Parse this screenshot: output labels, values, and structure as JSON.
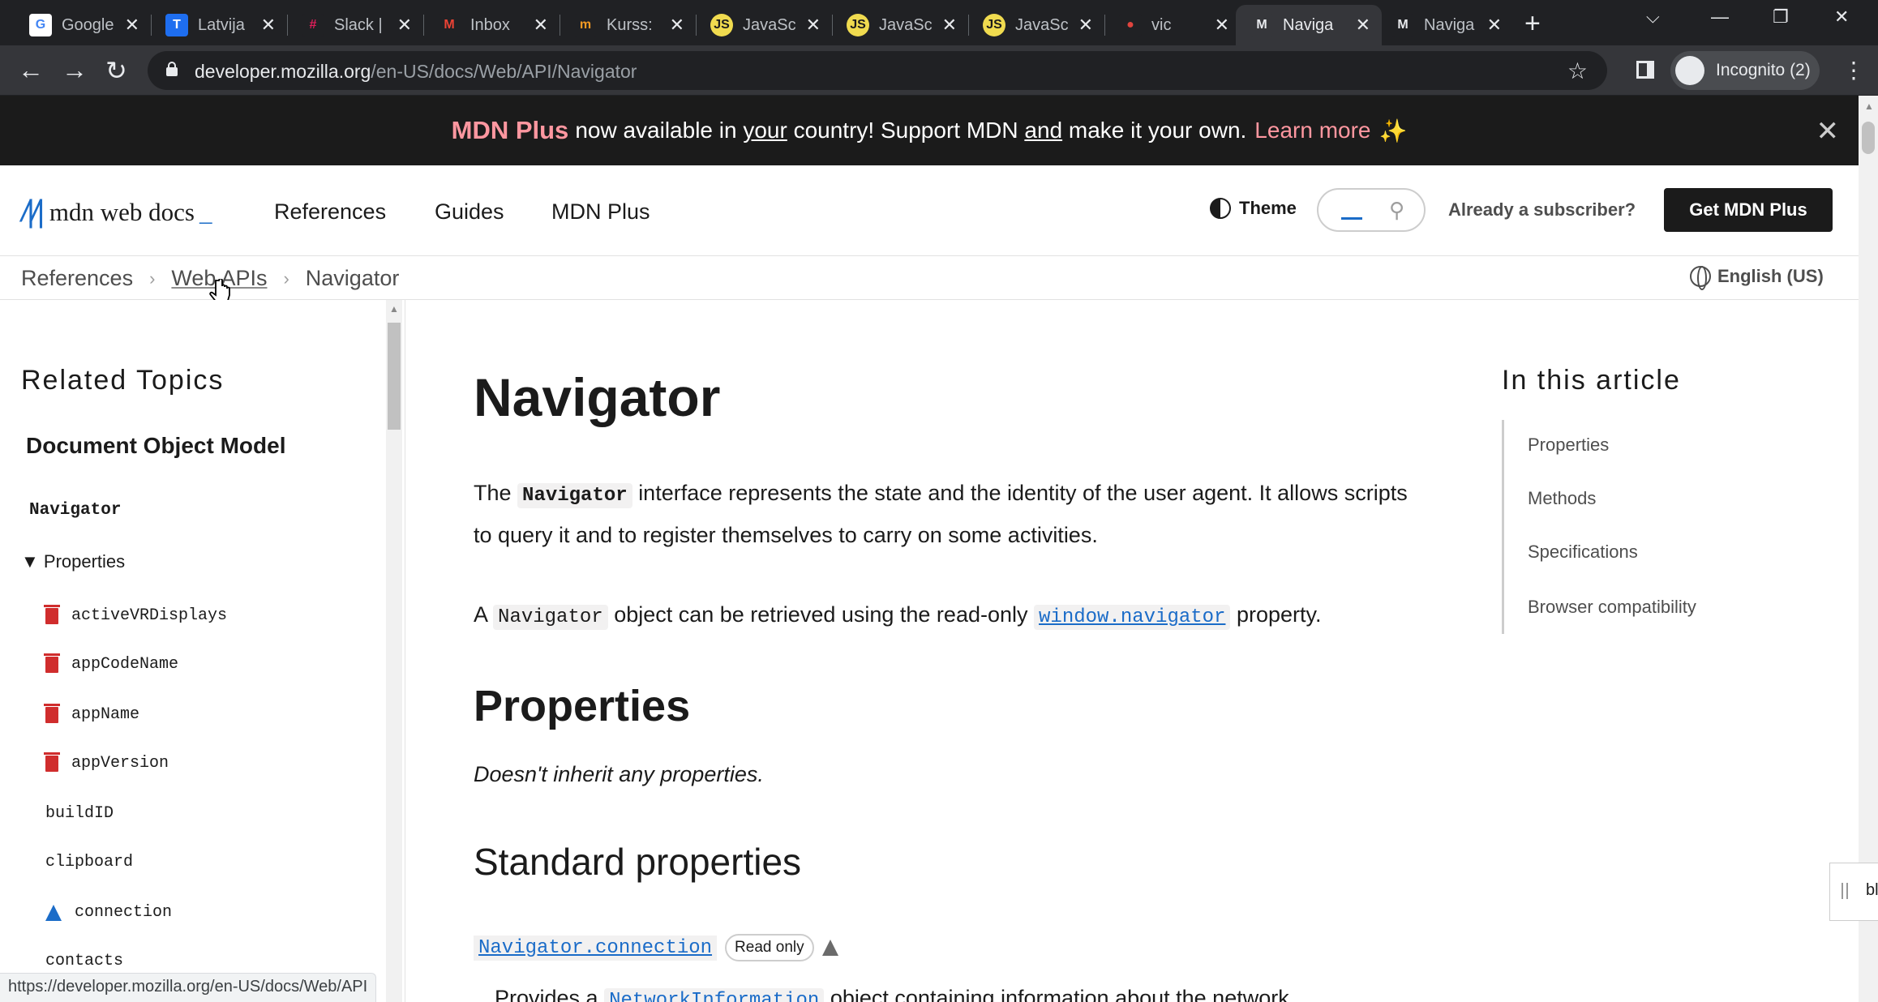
{
  "tabs": [
    {
      "title": "Google",
      "fav": "G",
      "fav_color": "#4285f4",
      "fav_bg": "#ffffff"
    },
    {
      "title": "Latvija",
      "fav": "T",
      "fav_color": "#ffffff",
      "fav_bg": "#1e6ef0"
    },
    {
      "title": "Slack |",
      "fav": "#",
      "fav_color": "#e01e5a",
      "fav_bg": "#202124"
    },
    {
      "title": "Inbox",
      "fav": "M",
      "fav_color": "#ea4335",
      "fav_bg": "#202124"
    },
    {
      "title": "Kurss:",
      "fav": "m",
      "fav_color": "#f59a23",
      "fav_bg": "#202124"
    },
    {
      "title": "JavaSc",
      "fav": "JS",
      "fav_color": "#1b1b1b",
      "fav_bg": "#f0db4f"
    },
    {
      "title": "JavaSc",
      "fav": "JS",
      "fav_color": "#1b1b1b",
      "fav_bg": "#f0db4f"
    },
    {
      "title": "JavaSc",
      "fav": "JS",
      "fav_color": "#1b1b1b",
      "fav_bg": "#f0db4f"
    },
    {
      "title": "vic",
      "fav": "●",
      "fav_color": "#e0443e",
      "fav_bg": "#202124"
    },
    {
      "title": "Naviga",
      "fav": "M",
      "fav_color": "#e8eaed",
      "fav_bg": "#35363a",
      "active": true
    },
    {
      "title": "Naviga",
      "fav": "M",
      "fav_color": "#e8eaed",
      "fav_bg": "#202124"
    }
  ],
  "toolbar": {
    "url_host": "developer.mozilla.org",
    "url_path": "/en-US/docs/Web/API/Navigator",
    "profile": "Incognito (2)"
  },
  "banner": {
    "brand": "MDN Plus",
    "t1": "now available in",
    "t2": "your",
    "t3": "country! Support MDN",
    "t4": "and",
    "t5": "make it your own.",
    "learn": "Learn more",
    "spark": "✨"
  },
  "header": {
    "logo": "mdn web docs",
    "nav": [
      "References",
      "Guides",
      "MDN Plus"
    ],
    "theme": "Theme",
    "already": "Already a subscriber?",
    "get_plus": "Get MDN Plus"
  },
  "breadcrumb": [
    "References",
    "Web APIs",
    "Navigator"
  ],
  "language": "English (US)",
  "sidebar": {
    "related": "Related Topics",
    "dom": "Document Object Model",
    "navigator": "Navigator",
    "properties": "Properties",
    "items": [
      {
        "name": "activeVRDisplays",
        "icon": "trash"
      },
      {
        "name": "appCodeName",
        "icon": "trash"
      },
      {
        "name": "appName",
        "icon": "trash"
      },
      {
        "name": "appVersion",
        "icon": "trash"
      },
      {
        "name": "buildID",
        "icon": "none"
      },
      {
        "name": "clipboard",
        "icon": "none"
      },
      {
        "name": "connection",
        "icon": "flask"
      },
      {
        "name": "contacts",
        "icon": "none"
      }
    ]
  },
  "main": {
    "title": "Navigator",
    "p1_a": "The",
    "p1_code": "Navigator",
    "p1_b": "interface represents the state and the identity of the user agent. It allows scripts to query it and to register themselves to carry on some activities.",
    "p2_a": "A",
    "p2_code": "Navigator",
    "p2_b": "object can be retrieved using the read-only",
    "p2_link": "window.navigator",
    "p2_c": "property.",
    "h_props": "Properties",
    "not_inherit": "Doesn't inherit any properties.",
    "h_std": "Standard properties",
    "prop1": "Navigator.connection",
    "prop1_badge": "Read only",
    "partial_a": "Provides a",
    "partial_code": "NetworkInformation",
    "partial_b": "object containing information about the network"
  },
  "toc": {
    "title": "In this article",
    "items": [
      "Properties",
      "Methods",
      "Specifications",
      "Browser compatibility"
    ]
  },
  "edge_widget": "bl",
  "status_url": "https://developer.mozilla.org/en-US/docs/Web/API"
}
